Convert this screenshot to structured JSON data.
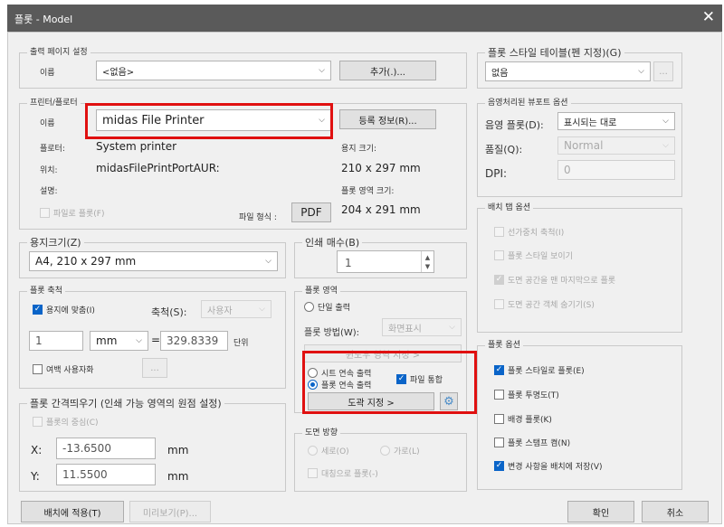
{
  "window": {
    "title": "플롯 - Model",
    "close_glyph": "✕"
  },
  "page_setup": {
    "label": "출력 페이지 설정",
    "name_label": "이름",
    "name_value": "<없음>",
    "add_button": "추가(.)..."
  },
  "printer": {
    "label": "프린터/플로터",
    "name_label": "이름",
    "name_value": "midas File Printer",
    "properties_button": "등록 정보(R)...",
    "plotter_label": "플로터:",
    "plotter_value": "System printer",
    "location_label": "위치:",
    "location_value": "midasFilePrintPortAUR:",
    "description_label": "설명:",
    "paper_size_label": "용지 크기:",
    "paper_size_value": "210 x 297 mm",
    "plot_area_label": "플롯 영역 크기:",
    "plot_area_value": "204 x 291 mm",
    "plot_to_file_label": "파일로 플롯(F)",
    "file_format_label": "파일 형식 :",
    "file_format_button": "PDF"
  },
  "paper_size": {
    "label": "용지크기(Z)",
    "value": "A4, 210 x 297 mm"
  },
  "copies": {
    "label": "인쇄 매수(B)",
    "value": "1"
  },
  "plot_scale": {
    "label": "플롯 축척",
    "fit_label": "용지에 맞춤(I)",
    "scale_label": "축척(S):",
    "scale_value": "사용자",
    "numerator": "1",
    "unit": "mm",
    "equals": "=",
    "denominator": "329.8339",
    "unit_label": "단위",
    "lineweight_label": "여백 사용자화",
    "margin_button": "..."
  },
  "plot_offset": {
    "label": "플롯 간격띄우기 (인쇄 가능 영역의 원점 설정)",
    "center_label": "플롯의 중심(C)",
    "x_label": "X:",
    "x_value": "-13.6500",
    "x_unit": "mm",
    "y_label": "Y:",
    "y_value": "11.5500",
    "y_unit": "mm"
  },
  "plot_area": {
    "label": "플롯 영역",
    "single_label": "단일 출력",
    "what_label": "플롯 방법(W):",
    "what_value": "화면표시",
    "window_button": "윈도우 영역 지정 >",
    "sheet_continuous_label": "시트 연속 출력",
    "plot_continuous_label": "플롯 연속 출력",
    "file_merge_label": "파일 통합",
    "drawing_select_button": "도곽 지정 >"
  },
  "orientation": {
    "label": "도면 방향",
    "portrait_label": "세로(O)",
    "landscape_label": "가로(L)",
    "upside_down_label": "대칭으로 플롯(-)"
  },
  "plot_style_table": {
    "label": "플롯 스타일 테이블(펜 지정)(G)",
    "value": "없음",
    "edit_button": "..."
  },
  "shaded_viewport": {
    "label": "음영처리된 뷰포트 옵션",
    "shade_label": "음영 플롯(D):",
    "shade_value": "표시되는 대로",
    "quality_label": "품질(Q):",
    "quality_value": "Normal",
    "dpi_label": "DPI:",
    "dpi_value": "0"
  },
  "layout_options": {
    "label": "배치 탭 옵션",
    "lineweight_label": "선가중치 축척(I)",
    "styles_label": "플롯 스타일 보이기",
    "paperspace_last_label": "도면 공간을 맨 마지막으로 플롯",
    "hide_label": "도면 공간 객체 숨기기(S)"
  },
  "plot_options": {
    "label": "플롯 옵션",
    "styles_label": "플롯 스타일로 플롯(E)",
    "transparency_label": "플롯 투명도(T)",
    "background_label": "배경 플롯(K)",
    "stamp_label": "플롯 스탬프 켬(N)",
    "save_label": "변경 사항을 배치에 저장(V)"
  },
  "footer": {
    "apply_button": "배치에 적용(T)",
    "preview_button": "미리보기(P)...",
    "ok_button": "확인",
    "cancel_button": "취소"
  },
  "colors": {
    "accent": "#0a64c8",
    "highlight": "#e01010",
    "titlebar": "#5a5a5a"
  },
  "icons": {
    "settings": "gear-icon",
    "close": "close-icon"
  }
}
